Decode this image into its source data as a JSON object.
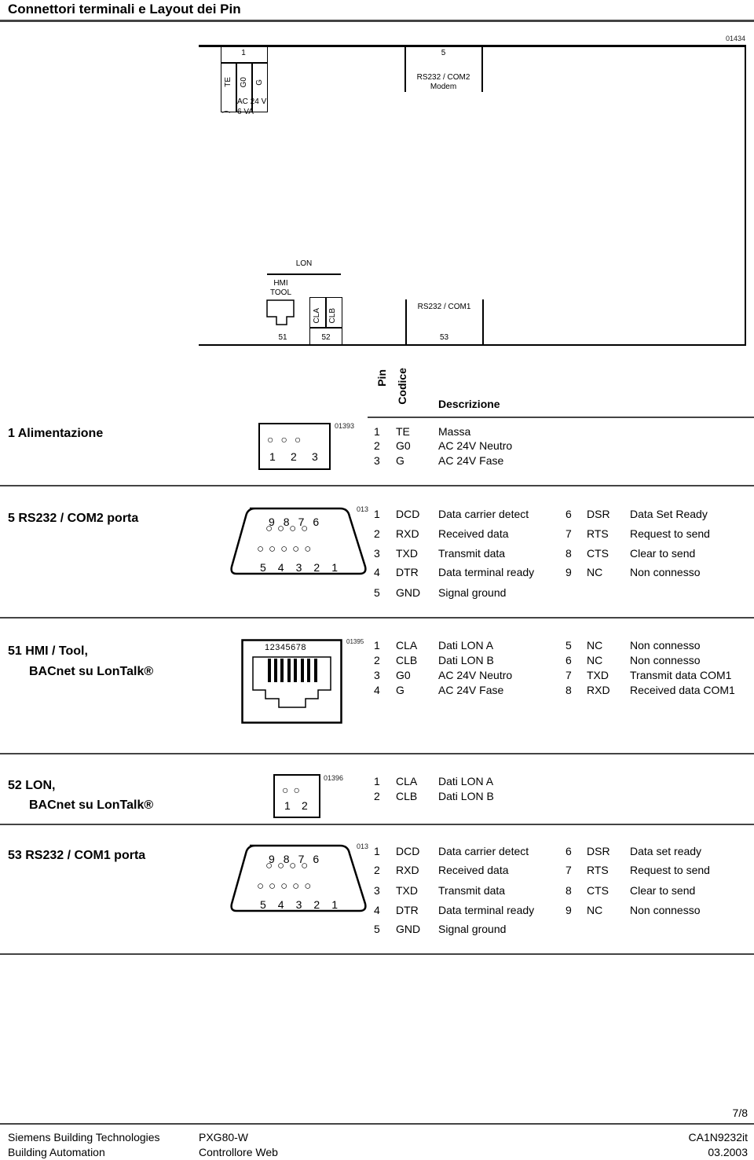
{
  "page": {
    "title": "Connettori terminali e Layout dei Pin",
    "page_number": "7/8"
  },
  "overview": {
    "figure_id": "01434",
    "terminal_1": {
      "number": "1",
      "pins": [
        "TE",
        "G0",
        "G"
      ],
      "supply_line1": "AC 24 V",
      "supply_line2": "6 VA"
    },
    "terminal_5": {
      "number": "5",
      "line1": "RS232 / COM2",
      "line2": "Modem"
    },
    "lon_label": "LON",
    "hmi_line1": "HMI",
    "hmi_line2": "TOOL",
    "terminal_52_pins": [
      "CLA",
      "CLB"
    ],
    "terminal_53_label": "RS232 / COM1",
    "numbers": [
      "51",
      "52",
      "53"
    ]
  },
  "table_header": {
    "pin": "Pin",
    "code": "Codice",
    "description": "Descrizione"
  },
  "sections": [
    {
      "title_line1": "1  Alimentazione",
      "figure_id": "01393",
      "connector_pins": [
        "1",
        "2",
        "3"
      ],
      "rows": [
        {
          "pin": "1",
          "code": "TE",
          "desc": "Massa"
        },
        {
          "pin": "2",
          "code": "G0",
          "desc": "AC 24V Neutro"
        },
        {
          "pin": "3",
          "code": "G",
          "desc": "AC 24V Fase"
        }
      ]
    },
    {
      "title_line1": "5   RS232 / COM2  porta",
      "figure_id": "013",
      "connector_top_pins": [
        "9",
        "8",
        "7",
        "6"
      ],
      "connector_bottom_pins": [
        "5",
        "4",
        "3",
        "2",
        "1"
      ],
      "rows_left": [
        {
          "pin": "1",
          "code": "DCD",
          "desc": "Data carrier detect"
        },
        {
          "pin": "2",
          "code": "RXD",
          "desc": "Received data"
        },
        {
          "pin": "3",
          "code": "TXD",
          "desc": "Transmit data"
        },
        {
          "pin": "4",
          "code": "DTR",
          "desc": "Data terminal ready"
        },
        {
          "pin": "5",
          "code": "GND",
          "desc": "Signal ground"
        }
      ],
      "rows_right": [
        {
          "pin": "6",
          "code": "DSR",
          "desc": "Data Set Ready"
        },
        {
          "pin": "7",
          "code": "RTS",
          "desc": "Request to send"
        },
        {
          "pin": "8",
          "code": "CTS",
          "desc": "Clear to send"
        },
        {
          "pin": "9",
          "code": "NC",
          "desc": "Non connesso"
        }
      ]
    },
    {
      "title_line1": "51 HMI / Tool,",
      "title_line2": "BACnet su LonTalk®",
      "figure_id": "01395",
      "connector_pins": "12345678",
      "rows_left": [
        {
          "pin": "1",
          "code": "CLA",
          "desc": "Dati LON A"
        },
        {
          "pin": "2",
          "code": "CLB",
          "desc": "Dati LON B"
        },
        {
          "pin": "3",
          "code": "G0",
          "desc": "AC 24V Neutro"
        },
        {
          "pin": "4",
          "code": "G",
          "desc": "AC 24V Fase"
        }
      ],
      "rows_right": [
        {
          "pin": "5",
          "code": "NC",
          "desc": "Non connesso"
        },
        {
          "pin": "6",
          "code": "NC",
          "desc": "Non connesso"
        },
        {
          "pin": "7",
          "code": "TXD",
          "desc": "Transmit data COM1"
        },
        {
          "pin": "8",
          "code": "RXD",
          "desc": "Received data COM1"
        }
      ]
    },
    {
      "title_line1": "52 LON,",
      "title_line2": "BACnet su LonTalk®",
      "figure_id": "01396",
      "connector_pins": [
        "1",
        "2"
      ],
      "rows": [
        {
          "pin": "1",
          "code": "CLA",
          "desc": "Dati LON A"
        },
        {
          "pin": "2",
          "code": "CLB",
          "desc": "Dati LON B"
        }
      ]
    },
    {
      "title_line1": "53 RS232 / COM1 porta",
      "figure_id": "013",
      "connector_top_pins": [
        "9",
        "8",
        "7",
        "6"
      ],
      "connector_bottom_pins": [
        "5",
        "4",
        "3",
        "2",
        "1"
      ],
      "rows_left": [
        {
          "pin": "1",
          "code": "DCD",
          "desc": "Data carrier detect"
        },
        {
          "pin": "2",
          "code": "RXD",
          "desc": "Received data"
        },
        {
          "pin": "3",
          "code": "TXD",
          "desc": "Transmit data"
        },
        {
          "pin": "4",
          "code": "DTR",
          "desc": "Data terminal ready"
        },
        {
          "pin": "5",
          "code": "GND",
          "desc": "Signal ground"
        }
      ],
      "rows_right": [
        {
          "pin": "6",
          "code": "DSR",
          "desc": "Data set ready"
        },
        {
          "pin": "7",
          "code": "RTS",
          "desc": "Request to send"
        },
        {
          "pin": "8",
          "code": "CTS",
          "desc": "Clear to send"
        },
        {
          "pin": "9",
          "code": "NC",
          "desc": "Non connesso"
        }
      ]
    }
  ],
  "footer": {
    "company_line1": "Siemens Building Technologies",
    "company_line2": "Building Automation",
    "product_line1": "PXG80-W",
    "product_line2": "Controllore Web",
    "doc_line1": "CA1N9232it",
    "doc_line2": "03.2003"
  }
}
